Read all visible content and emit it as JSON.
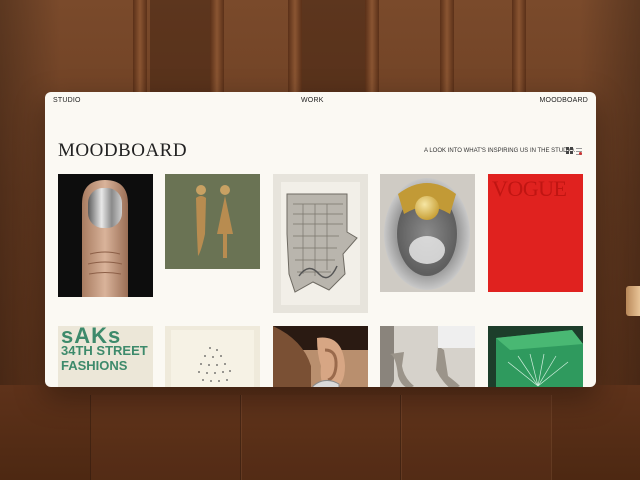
{
  "nav": {
    "left": "STUDIO",
    "center": "WORK",
    "right": "MOODBOARD"
  },
  "page": {
    "title": "MOODBOARD",
    "tagline": "A LOOK INTO WHAT'S INSPIRING US IN THE STUDIO."
  },
  "view_toggles": {
    "grid_icon": "grid-icon",
    "list_icon": "list-icon",
    "active": "grid"
  },
  "cards": {
    "saks": {
      "line1": "sAKs",
      "line2": "34TH STREET",
      "line3": "FASHIONS"
    },
    "vogue": {
      "masthead": "VOGUE"
    }
  },
  "colors": {
    "background_wood": "#6a3d22",
    "window_bg": "#fbf9f3",
    "vogue_red": "#e0221f",
    "saks_green": "#3d8a6b"
  }
}
